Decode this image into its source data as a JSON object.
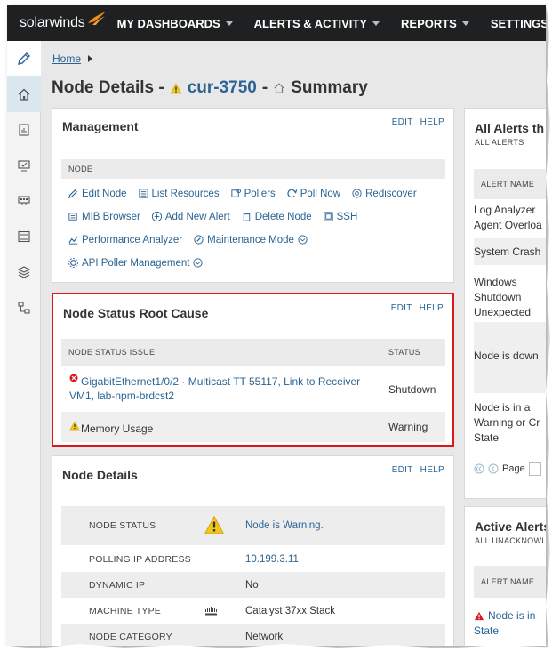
{
  "nav": {
    "logo": "solarwinds",
    "items": [
      "MY DASHBOARDS",
      "ALERTS & ACTIVITY",
      "REPORTS",
      "SETTINGS"
    ]
  },
  "sidebar": {
    "icons": [
      "pencil-icon",
      "home-icon",
      "report-icon",
      "monitor-icon",
      "network-port-icon",
      "list-icon",
      "layers-icon",
      "topology-icon"
    ]
  },
  "breadcrumb": {
    "home": "Home"
  },
  "title": {
    "prefix": "Node Details -",
    "node": "cur-3750",
    "sep": "-",
    "view": "Summary"
  },
  "panel_actions": {
    "edit": "EDIT",
    "help": "HELP"
  },
  "management": {
    "title": "Management",
    "section": "NODE",
    "rows": [
      [
        {
          "label": "Edit Node",
          "icon": "pencil-icon"
        },
        {
          "label": "List Resources",
          "icon": "list-icon"
        },
        {
          "label": "Pollers",
          "icon": "poller-icon"
        },
        {
          "label": "Poll Now",
          "icon": "refresh-icon"
        },
        {
          "label": "Rediscover",
          "icon": "rediscover-icon"
        }
      ],
      [
        {
          "label": "MIB Browser",
          "icon": "mib-icon"
        },
        {
          "label": "Add New Alert",
          "icon": "plus-circle-icon"
        },
        {
          "label": "Delete Node",
          "icon": "trash-icon"
        },
        {
          "label": "SSH",
          "icon": "terminal-icon"
        }
      ],
      [
        {
          "label": "Performance Analyzer",
          "icon": "analyzer-icon"
        },
        {
          "label": "Maintenance Mode",
          "icon": "maintenance-icon"
        }
      ],
      [
        {
          "label": "API Poller Management",
          "icon": "gear-icon"
        }
      ]
    ]
  },
  "root_cause": {
    "title": "Node Status Root Cause",
    "col_issue": "NODE STATUS ISSUE",
    "col_status": "STATUS",
    "rows": [
      {
        "issue_line1": "GigabitEthernet1/0/2 · Multicast TT 55117, Link to Receiver",
        "issue_line2": "VM1, lab-npm-brdcst2",
        "status": "Shutdown"
      },
      {
        "issue_line1": "Memory Usage",
        "issue_line2": "",
        "status": "Warning"
      }
    ],
    "highlight_color": "#d9171d"
  },
  "details": {
    "title": "Node Details",
    "rows": [
      {
        "label": "NODE STATUS",
        "value": "Node is Warning."
      },
      {
        "label": "POLLING IP ADDRESS",
        "value": "10.199.3.11"
      },
      {
        "label": "DYNAMIC IP",
        "value": "No"
      },
      {
        "label": "MACHINE TYPE",
        "value": "Catalyst 37xx Stack"
      },
      {
        "label": "NODE CATEGORY",
        "value": "Network"
      }
    ]
  },
  "all_alerts": {
    "title": "All Alerts th",
    "subtitle": "ALL ALERTS",
    "col": "ALERT NAME",
    "items": [
      [
        "Log Analyzer",
        "Agent Overloa"
      ],
      [
        "System Crash"
      ],
      [
        "Windows",
        "Shutdown",
        "Unexpected"
      ],
      [
        "Node is down"
      ],
      [
        "Node is in a",
        "Warning or Cr",
        "State"
      ]
    ],
    "pager": "Page"
  },
  "active_alerts": {
    "title": "Active Alerts",
    "subtitle": "ALL UNACKNOWL",
    "col": "ALERT NAME",
    "item_line1": "Node is in",
    "item_line2": "State"
  }
}
